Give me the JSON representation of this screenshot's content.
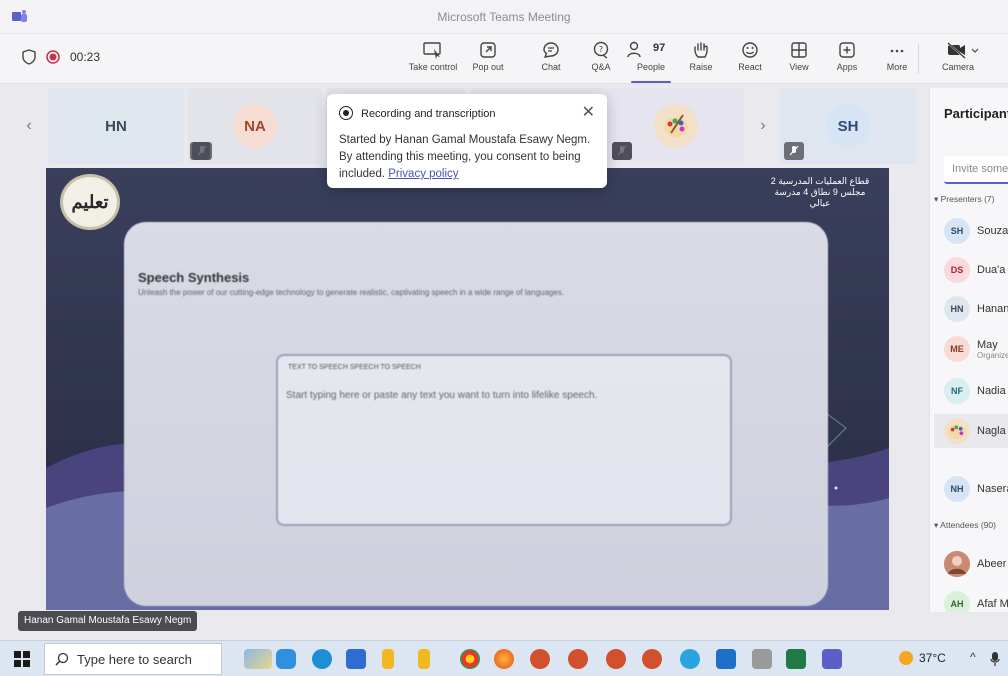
{
  "window": {
    "title": "Microsoft Teams Meeting"
  },
  "meeting": {
    "timer": "00:23"
  },
  "toolbar": {
    "take_control": "Take control",
    "pop_out": "Pop out",
    "chat": "Chat",
    "qa": "Q&A",
    "people": "People",
    "people_count": "97",
    "raise": "Raise",
    "react": "React",
    "view": "View",
    "apps": "Apps",
    "more": "More",
    "camera": "Camera"
  },
  "strip": {
    "tiles": [
      {
        "initials": "HN",
        "color": "#dfe7ee"
      },
      {
        "initials": "NA",
        "color": "#f6dcd2"
      },
      {
        "initials": "SH",
        "color": "#d7e4f4"
      }
    ]
  },
  "popup": {
    "title": "Recording and transcription",
    "body": "Started by Hanan Gamal Moustafa Esawy Negm. By attending this meeting, you consent to being included.",
    "link": "Privacy policy"
  },
  "video": {
    "presenter_name": "Hanan Gamal Moustafa Esawy Negm",
    "logo_text": "تعليم",
    "arabic_note": "قطاع العمليات المدرسية 2 مجلس 9 نطاق 4 مدرسة عبالي",
    "screen_title": "Speech Synthesis",
    "screen_subtitle": "Unleash the power of our cutting-edge technology to generate realistic, captivating speech in a wide range of languages.",
    "screen_tabs": "TEXT TO SPEECH    SPEECH TO SPEECH",
    "screen_placeholder": "Start typing here or paste any text you want to turn into lifelike speech."
  },
  "participants": {
    "title": "Participants",
    "invite_placeholder": "Invite someone",
    "presenters_label": "Presenters (7)",
    "attendees_label": "Attendees (90)",
    "presenters": [
      {
        "initials": "SH",
        "name": "Souzan",
        "color": "#d7e4f4",
        "fg": "#2e4a74"
      },
      {
        "initials": "DS",
        "name": "Dua'a",
        "color": "#f9d9de",
        "fg": "#a3233c"
      },
      {
        "initials": "HN",
        "name": "Hanan",
        "color": "#dfe7ee",
        "fg": "#3b4a5a"
      },
      {
        "initials": "ME",
        "name": "May",
        "sub": "Organizer",
        "color": "#f6dcd2",
        "fg": "#8a3a22"
      },
      {
        "initials": "NF",
        "name": "Nadia",
        "color": "#d9eef0",
        "fg": "#1e6c74"
      },
      {
        "initials": "",
        "name": "Nagla",
        "color": "#f2e0c8",
        "fg": "#333"
      },
      {
        "initials": "NH",
        "name": "Nasera",
        "color": "#d7e4f4",
        "fg": "#2e4a74"
      }
    ],
    "attendees": [
      {
        "initials": "",
        "name": "Abeer",
        "color": "#d9a895",
        "fg": "#333"
      },
      {
        "initials": "AH",
        "name": "Afaf M",
        "color": "#dcefdc",
        "fg": "#2d6a2d"
      }
    ]
  },
  "taskbar": {
    "search_placeholder": "Type here to search",
    "temperature": "37°C"
  }
}
